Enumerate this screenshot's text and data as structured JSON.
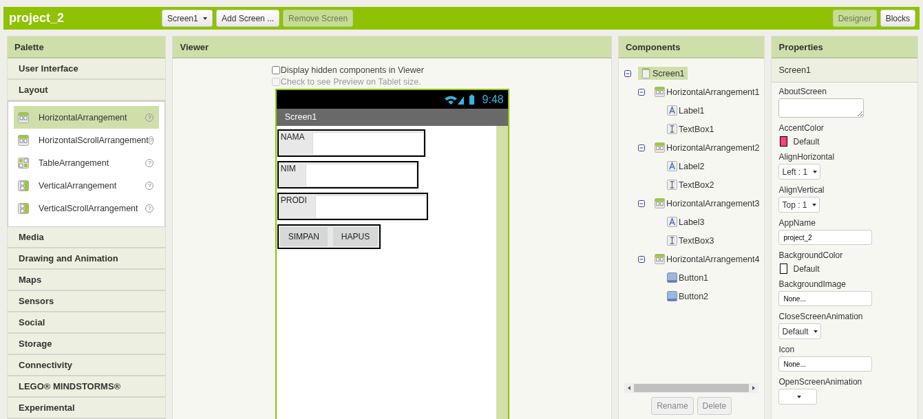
{
  "topbar": {
    "project": "project_2",
    "screen_select": "Screen1",
    "buttons": [
      {
        "label": "Add Screen ...",
        "disabled": false
      },
      {
        "label": "Remove Screen",
        "disabled": true
      }
    ],
    "views": [
      {
        "label": "Designer",
        "selected": true
      },
      {
        "label": "Blocks",
        "selected": false
      }
    ]
  },
  "palette": {
    "title": "Palette",
    "sections": [
      {
        "label": "User Interface"
      },
      {
        "label": "Layout",
        "items": [
          {
            "label": "HorizontalArrangement",
            "kind": "horizontal",
            "selected": true,
            "help": "?"
          },
          {
            "label": "HorizontalScrollArrangement",
            "kind": "horizontal",
            "selected": false,
            "help": "?"
          },
          {
            "label": "TableArrangement",
            "kind": "table",
            "selected": false,
            "help": "?"
          },
          {
            "label": "VerticalArrangement",
            "kind": "vertical",
            "selected": false,
            "help": "?"
          },
          {
            "label": "VerticalScrollArrangement",
            "kind": "vertical",
            "selected": false,
            "help": "?"
          }
        ]
      },
      {
        "label": "Media"
      },
      {
        "label": "Drawing and Animation"
      },
      {
        "label": "Maps"
      },
      {
        "label": "Sensors"
      },
      {
        "label": "Social"
      },
      {
        "label": "Storage"
      },
      {
        "label": "Connectivity"
      },
      {
        "label": "LEGO® MINDSTORMS®"
      },
      {
        "label": "Experimental"
      }
    ]
  },
  "viewer": {
    "title": "Viewer",
    "options": [
      {
        "label": "Display hidden components in Viewer",
        "checked": false,
        "disabled": false
      },
      {
        "label": "Check to see Preview on Tablet size.",
        "checked": false,
        "disabled": true
      }
    ],
    "phone": {
      "time": "9:48",
      "screen_title": "Screen1",
      "rows": [
        {
          "kind": "field",
          "label": "NAMA"
        },
        {
          "kind": "field",
          "label": "NIM"
        },
        {
          "kind": "field",
          "label": "PRODI"
        },
        {
          "kind": "buttons",
          "buttons": [
            "SIMPAN",
            "HAPUS"
          ]
        }
      ]
    }
  },
  "components": {
    "title": "Components",
    "tree": [
      {
        "name": "Screen1",
        "kind": "screen",
        "selected": true,
        "expanded": true,
        "children": [
          {
            "name": "HorizontalArrangement1",
            "kind": "horizontal",
            "selected": false,
            "expanded": true,
            "children": [
              {
                "name": "Label1",
                "kind": "label",
                "selected": false
              },
              {
                "name": "TextBox1",
                "kind": "textbox",
                "selected": false
              }
            ]
          },
          {
            "name": "HorizontalArrangement2",
            "kind": "horizontal",
            "selected": false,
            "expanded": true,
            "children": [
              {
                "name": "Label2",
                "kind": "label",
                "selected": false
              },
              {
                "name": "TextBox2",
                "kind": "textbox",
                "selected": false
              }
            ]
          },
          {
            "name": "HorizontalArrangement3",
            "kind": "horizontal",
            "selected": false,
            "expanded": true,
            "children": [
              {
                "name": "Label3",
                "kind": "label",
                "selected": false
              },
              {
                "name": "TextBox3",
                "kind": "textbox",
                "selected": false
              }
            ]
          },
          {
            "name": "HorizontalArrangement4",
            "kind": "horizontal",
            "selected": false,
            "expanded": true,
            "children": [
              {
                "name": "Button1",
                "kind": "button",
                "selected": false
              },
              {
                "name": "Button2",
                "kind": "button",
                "selected": false
              }
            ]
          }
        ]
      }
    ],
    "buttons": [
      {
        "label": "Rename",
        "disabled": true
      },
      {
        "label": "Delete",
        "disabled": true
      }
    ]
  },
  "properties": {
    "title": "Properties",
    "component": "Screen1",
    "items": [
      {
        "name": "AboutScreen",
        "kind": "textarea"
      },
      {
        "name": "AccentColor",
        "kind": "color",
        "value": "Default",
        "color": "#ff4081"
      },
      {
        "name": "AlignHorizontal",
        "kind": "select",
        "value": "Left : 1"
      },
      {
        "name": "AlignVertical",
        "kind": "select",
        "value": "Top : 1"
      },
      {
        "name": "AppName",
        "kind": "input",
        "value": "project_2"
      },
      {
        "name": "BackgroundColor",
        "kind": "color",
        "value": "Default",
        "color": "#ffffff"
      },
      {
        "name": "BackgroundImage",
        "kind": "input",
        "value": "None..."
      },
      {
        "name": "CloseScreenAnimation",
        "kind": "select",
        "value": "Default"
      },
      {
        "name": "Icon",
        "kind": "input",
        "value": "None..."
      },
      {
        "name": "OpenScreenAnimation",
        "kind": "select"
      }
    ]
  }
}
